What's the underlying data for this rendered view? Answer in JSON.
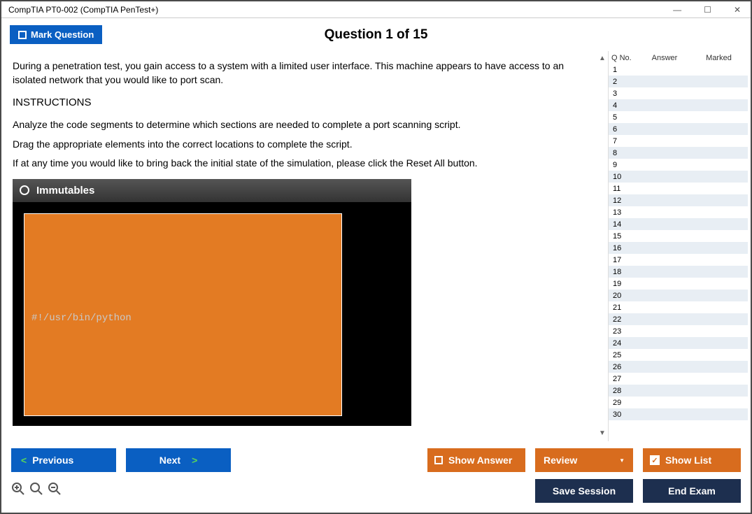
{
  "window": {
    "title": "CompTIA PT0-002 (CompTIA PenTest+)"
  },
  "header": {
    "mark_label": "Mark Question",
    "counter": "Question 1 of 15"
  },
  "question": {
    "intro": "During a penetration test, you gain access to a system with a limited user interface. This machine appears to have access to an isolated network that you would like to port scan.",
    "instructions_label": "INSTRUCTIONS",
    "instr_line1": "Analyze the code segments to determine which sections are needed to complete a port scanning script.",
    "instr_line2": "Drag the appropriate elements into the correct locations to complete the script.",
    "instr_line3": "If at any time you would like to bring back the initial state of the simulation, please click the Reset All button.",
    "sim_title": "Immutables",
    "code_line": "#!/usr/bin/python"
  },
  "sidebar": {
    "col_qno": "Q No.",
    "col_answer": "Answer",
    "col_marked": "Marked",
    "rows": [
      1,
      2,
      3,
      4,
      5,
      6,
      7,
      8,
      9,
      10,
      11,
      12,
      13,
      14,
      15,
      16,
      17,
      18,
      19,
      20,
      21,
      22,
      23,
      24,
      25,
      26,
      27,
      28,
      29,
      30
    ]
  },
  "footer": {
    "previous": "Previous",
    "next": "Next",
    "show_answer": "Show Answer",
    "review": "Review",
    "show_list": "Show List",
    "save_session": "Save Session",
    "end_exam": "End Exam"
  }
}
